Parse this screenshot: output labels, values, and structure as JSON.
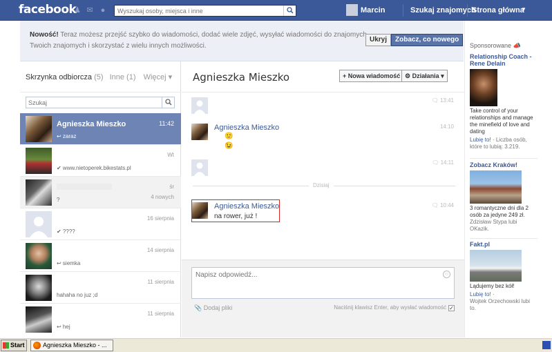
{
  "header": {
    "logo": "facebook",
    "search_placeholder": "Wyszukaj osoby, miejsca i inne",
    "user_name": "Marcin",
    "find_friends": "Szukaj znajomych",
    "home": "Strona główna"
  },
  "notice": {
    "bold": "Nowość!",
    "text": "Teraz możesz przejść szybko do wiadomości, dodać wiele zdjęć, wysyłać wiadomości do znajomych Twoich znajomych i skorzystać z wielu innych możliwości.",
    "hide": "Ukryj",
    "see_new": "Zobacz, co nowego"
  },
  "inbox": {
    "tab_inbox": "Skrzynka odbiorcza",
    "tab_inbox_count": "(5)",
    "tab_other": "Inne (1)",
    "tab_more": "Więcej ▾",
    "search_placeholder": "Szukaj",
    "threads": [
      {
        "name": "Agnieszka Mieszko",
        "snippet": "↩ zaraz",
        "time": "11:42"
      },
      {
        "name": "",
        "snippet": "✔ www.nietoperek.bikestats.pl",
        "time": "Wt"
      },
      {
        "name": "",
        "snippet": "?",
        "time": "śr",
        "extra": "4 nowych"
      },
      {
        "name": "",
        "snippet": "✔ ????",
        "time": "16 sierpnia"
      },
      {
        "name": "",
        "snippet": "↩ siemka",
        "time": "14 sierpnia"
      },
      {
        "name": "",
        "snippet": "hahaha no juz ;d",
        "time": "11 sierpnia"
      },
      {
        "name": "",
        "snippet": "↩ hej",
        "time": "11 sierpnia"
      }
    ]
  },
  "conversation": {
    "title": "Agnieszka Mieszko",
    "new_message": "+ Nowa wiadomość",
    "actions": "⚙ Działania ▾",
    "divider": "Dzisiaj",
    "messages": [
      {
        "sender": "",
        "lines": [],
        "time": "13:41"
      },
      {
        "sender": "Agnieszka Mieszko",
        "lines": [
          "🙂",
          "😉"
        ],
        "time": "14:10"
      },
      {
        "sender": "",
        "lines": [],
        "time": "14:11"
      },
      {
        "sender": "Agnieszka Mieszko",
        "lines": [
          "na rower, już !"
        ],
        "time": "10:44"
      }
    ],
    "reply_placeholder": "Napisz odpowiedź...",
    "attach": "Dodaj pliki",
    "enter_hint": "Naciśnij klawisz Enter, aby wysłać wiadomość"
  },
  "sponsored": {
    "heading": "Sponsorowane",
    "ads": [
      {
        "title": "Relationship Coach - Rene Delain",
        "body": "Take control of your relationships and manage the minefield of love and dating",
        "like": "Lubię to!",
        "like_rest": "· Liczba osób, które to lubią: 3.219."
      },
      {
        "title": "Zobacz Kraków!",
        "body": "3 romantyczne dni dla 2 osób za jedyne 249 zł.",
        "note": "Zdzisław Stypa lubi OKazik."
      },
      {
        "title": "Fakt.pl",
        "body": "Lądujemy bez kół!",
        "like": "Lubię to!",
        "like_rest": "·",
        "note": "Wojtek Orzechowski lubi to."
      }
    ]
  },
  "taskbar": {
    "start": "Start",
    "window": "Agnieszka Mieszko - ..."
  },
  "colors": {
    "brand": "#3b5998",
    "selected_thread": "#6d84b4",
    "highlight": "#dd2222"
  }
}
